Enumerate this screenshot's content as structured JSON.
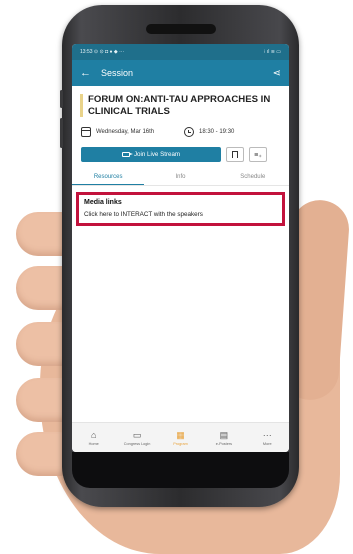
{
  "status_bar": {
    "time": "13:53",
    "left_icons": "⊙ ⊙ ◘ ● ◆ ···",
    "right_icons": "⁝ ıl ≋ ▭"
  },
  "app_bar": {
    "title": "Session"
  },
  "session": {
    "title": "FORUM ON:ANTI-TAU APPROACHES IN CLINICAL TRIALS",
    "date": "Wednesday, Mar 16th",
    "time_range": "18:30 - 19:30"
  },
  "actions": {
    "live_stream_label": "Join Live Stream",
    "filter_icon": "≡₊"
  },
  "tabs": [
    {
      "label": "Resources",
      "active": true
    },
    {
      "label": "Info",
      "active": false
    },
    {
      "label": "Schedule",
      "active": false
    }
  ],
  "media": {
    "title": "Media links",
    "link_text": "Click here to INTERACT with the speakers"
  },
  "bottom_nav": [
    {
      "label": "Home",
      "icon": "⌂",
      "active": false
    },
    {
      "label": "Congress Login",
      "icon": "▭",
      "active": false
    },
    {
      "label": "Program",
      "icon": "▦",
      "active": true
    },
    {
      "label": "e-Posters",
      "icon": "▤",
      "active": false
    },
    {
      "label": "More",
      "icon": "···",
      "active": false
    }
  ],
  "colors": {
    "primary": "#1f7fa3",
    "highlight_box": "#c2123c",
    "active_nav": "#e8a23a"
  }
}
